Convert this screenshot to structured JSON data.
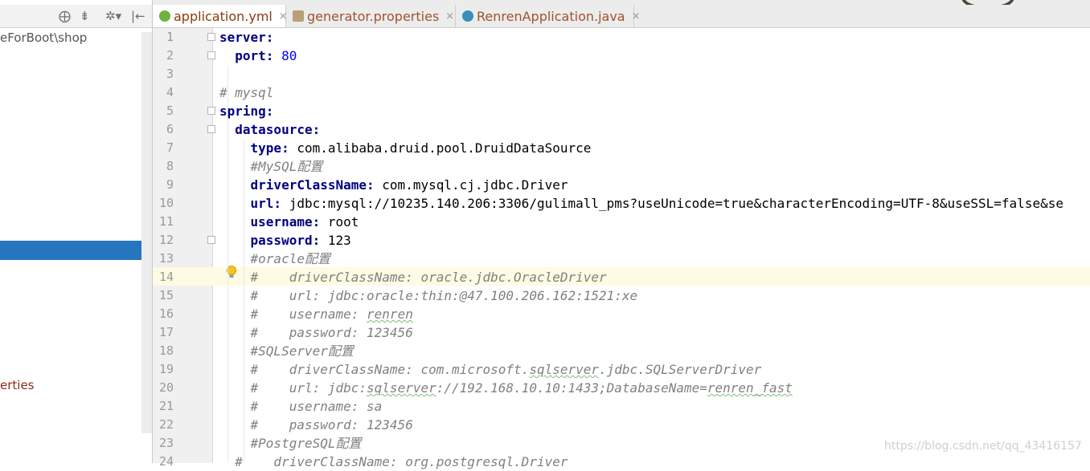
{
  "left_panel": {
    "path_text": "eForBoot\\shop",
    "properties_text": "erties"
  },
  "left_toolbar": {
    "icons": [
      "crosshair-icon",
      "collapse-icon",
      "gear-icon",
      "hide-panel-icon"
    ],
    "glyphs": [
      "⨁",
      "⇟",
      "✲▾",
      "|←"
    ]
  },
  "tabs": [
    {
      "label": "application.yml",
      "icon": "yaml-file-icon",
      "active": true
    },
    {
      "label": "generator.properties",
      "icon": "properties-file-icon",
      "active": false
    },
    {
      "label": "RenrenApplication.java",
      "icon": "java-class-icon",
      "active": false
    }
  ],
  "close_glyph": "×",
  "line_numbers": [
    "1",
    "2",
    "3",
    "4",
    "5",
    "6",
    "7",
    "8",
    "9",
    "10",
    "11",
    "12",
    "13",
    "14",
    "15",
    "16",
    "17",
    "18",
    "19",
    "20",
    "21",
    "22",
    "23",
    "24"
  ],
  "code": {
    "l1_key": "server:",
    "l2_key": "port:",
    "l2_val": "80",
    "l4_comment": "# mysql",
    "l5_key": "spring:",
    "l6_key": "datasource:",
    "l7_key": "type:",
    "l7_val": " com.alibaba.druid.pool.DruidDataSource",
    "l8_comment": "#MySQL配置",
    "l9_key": "driverClassName:",
    "l9_val": " com.mysql.cj.jdbc.Driver",
    "l10_key": "url:",
    "l10_val": " jdbc:mysql://10235.140.206:3306/gulimall_pms?useUnicode=true&characterEncoding=UTF-8&useSSL=false&se",
    "l11_key": "username:",
    "l11_val": " root",
    "l12_key": "password:",
    "l12_val": " 123",
    "l13_comment": "#oracle配置",
    "l14_comment": "#    driverClassName: oracle.jdbc.OracleDriver",
    "l15_comment": "#    url: jdbc:oracle:thin:@47.100.206.162:1521:xe",
    "l16_pre": "#    username: ",
    "l16_u": "renren",
    "l17_comment": "#    password: 123456",
    "l18_comment": "#SQLServer配置",
    "l19_pre": "#    driverClassName: com.microsoft.",
    "l19_u": "sqlserver",
    "l19_post": ".jdbc.SQLServerDriver",
    "l20_pre": "#    url: jdbc:",
    "l20_u": "sqlserver",
    "l20_mid": "://192.168.10.10:1433;DatabaseName=",
    "l20_u2": "renren_fast",
    "l21_comment": "#    username: sa",
    "l22_comment": "#    password: 123456",
    "l23_comment": "#PostgreSQL配置",
    "l24_comment": "#    driverClassName: org.postgresql.Driver"
  },
  "watermark": "https://blog.csdn.net/qq_43416157",
  "colors": {
    "selection": "#2675bf",
    "keyword": "#000080",
    "number": "#0000ff",
    "comment": "#808080",
    "current_line": "#fdfbe4"
  }
}
